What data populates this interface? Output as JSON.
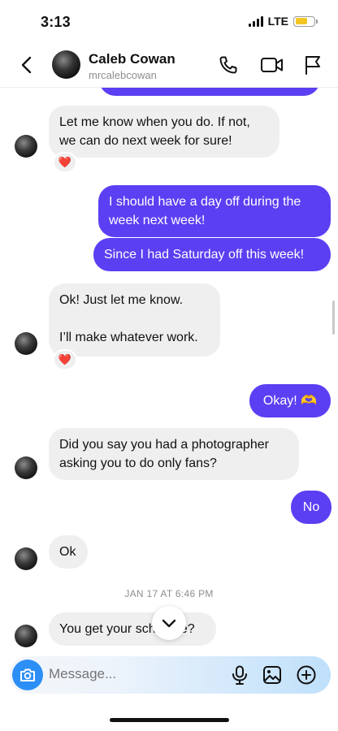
{
  "status_bar": {
    "time": "3:13",
    "network": "LTE",
    "battery_color": "#f3c623"
  },
  "header": {
    "name": "Caleb Cowan",
    "username": "mrcalebcowan",
    "icons": [
      "back-chevron-icon",
      "phone-icon",
      "video-icon",
      "flag-icon"
    ]
  },
  "messages": [
    {
      "from": "them",
      "text": "Let me know when you do. If not, we can do next week for sure!",
      "reaction": "❤️"
    },
    {
      "from": "me",
      "text": "I should have a day off during the week next week!"
    },
    {
      "from": "me",
      "text": "Since I had Saturday off this week!"
    },
    {
      "from": "them",
      "line1": "Ok! Just let me know.",
      "line2": "I’ll make whatever work.",
      "reaction": "❤️"
    },
    {
      "from": "me",
      "text": "Okay! 🫶"
    },
    {
      "from": "them",
      "text": "Did you say you had a photographer asking you to do only fans?"
    },
    {
      "from": "me",
      "text": "No"
    },
    {
      "from": "them",
      "text": "Ok"
    },
    {
      "from": "them",
      "text": "You get your schedule?"
    }
  ],
  "timestamp": "JAN 17 AT 6:46 PM",
  "composer": {
    "placeholder": "Message...",
    "icons": [
      "camera-icon",
      "microphone-icon",
      "image-icon",
      "plus-circle-icon"
    ]
  },
  "colors": {
    "outgoing_bubble": "#5b3ff2",
    "incoming_bubble": "#efefef",
    "camera_button": "#2d8ff5"
  }
}
